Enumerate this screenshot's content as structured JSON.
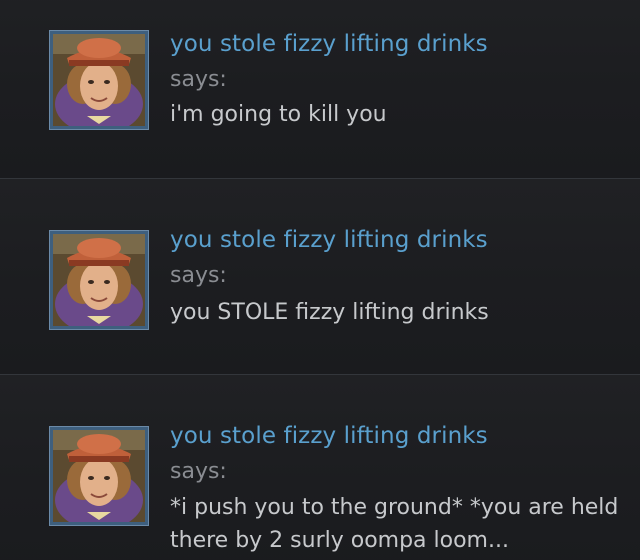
{
  "messages": [
    {
      "username": "you stole fizzy lifting drinks",
      "says": "says:",
      "text": "i'm going to kill you"
    },
    {
      "username": "you stole fizzy lifting drinks",
      "says": "says:",
      "text": "you STOLE fizzy lifting drinks"
    },
    {
      "username": "you stole fizzy lifting drinks",
      "says": "says:",
      "text": "*i push you to the ground* *you are held there by 2 surly oompa loom..."
    }
  ],
  "colors": {
    "background": "#1a1b1d",
    "username": "#5aa0ce",
    "says": "#8a8d92",
    "text": "#c7c9cc",
    "avatar_border": "#3e5f7e"
  },
  "icons": [
    "user-avatar-portrait"
  ]
}
